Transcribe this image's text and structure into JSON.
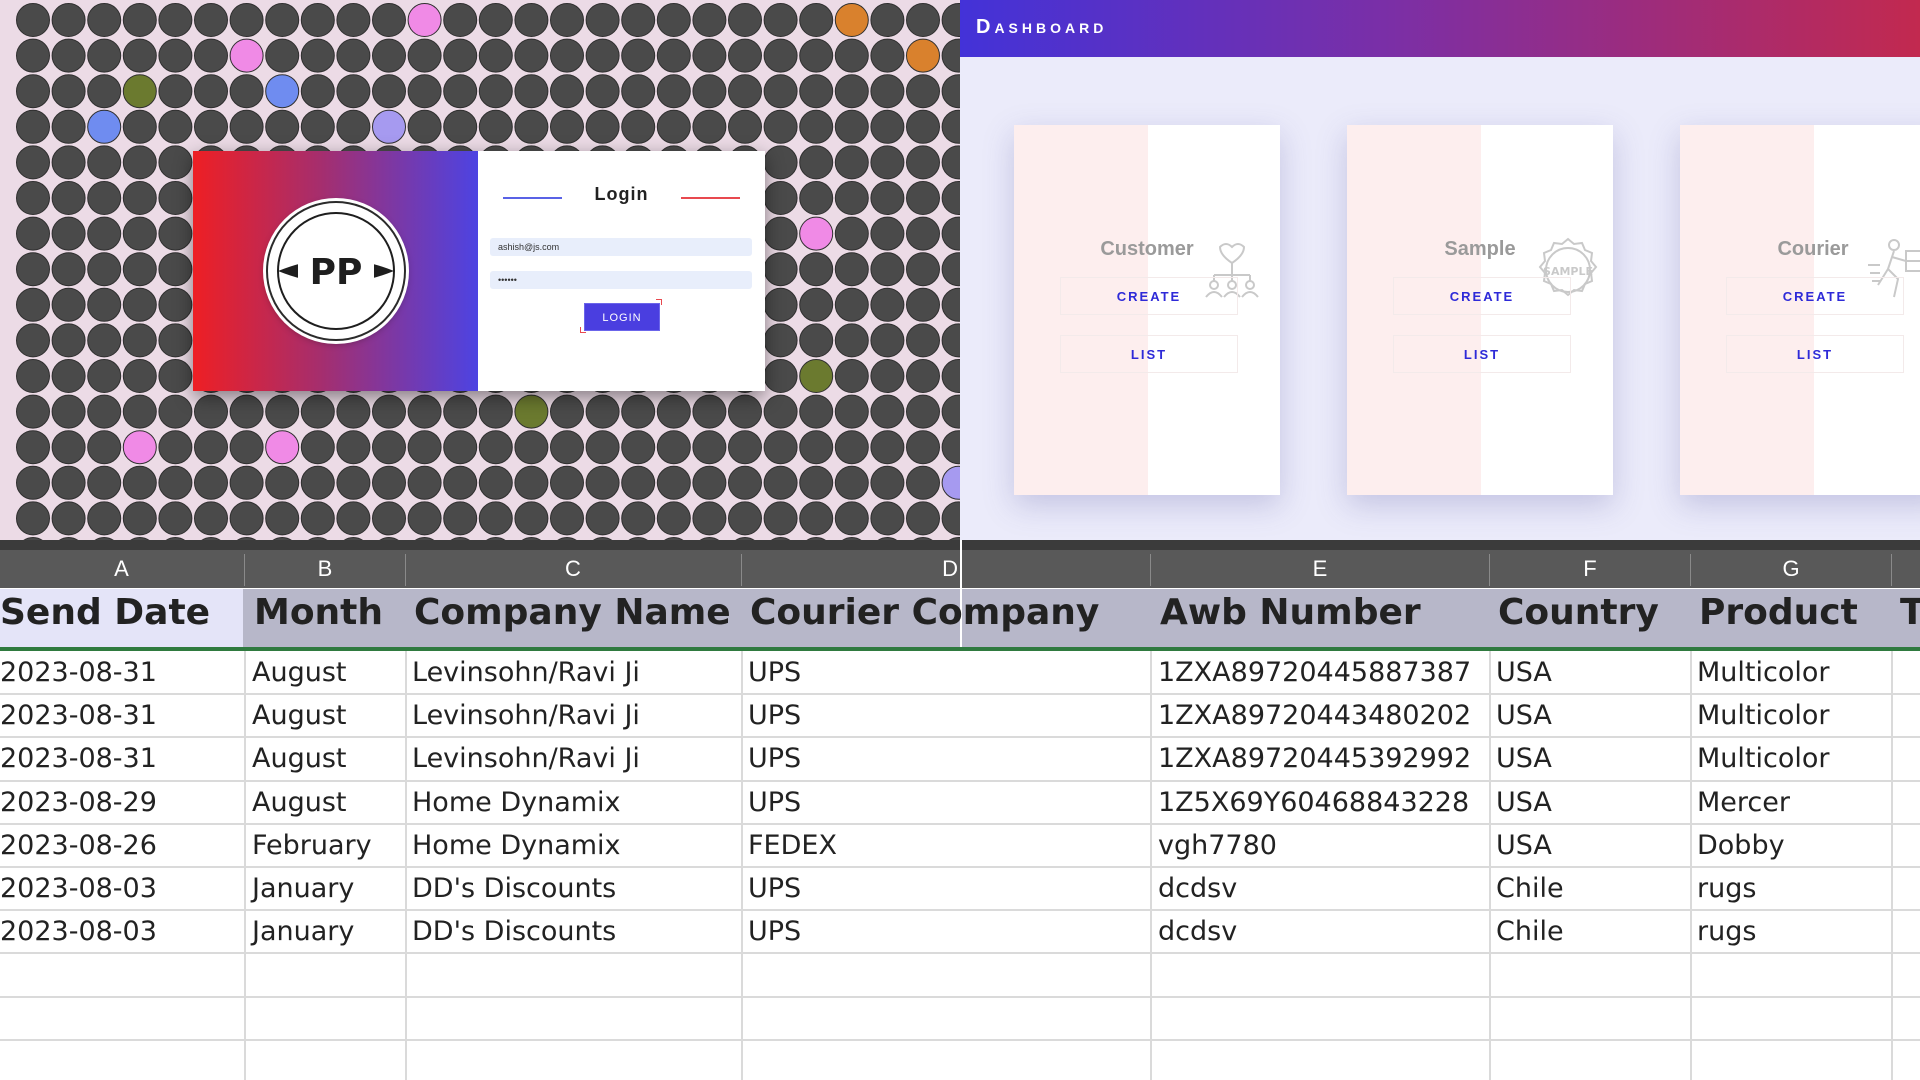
{
  "login": {
    "title": "Login",
    "email_value": "ashish@js.com",
    "password_value": "••••••",
    "button_label": "LOGIN",
    "logo_text": "PP"
  },
  "dashboard": {
    "title": "Dashboard",
    "cards": [
      {
        "title": "Customer",
        "icon": "customer-network-icon",
        "create_label": "CREATE",
        "list_label": "LIST"
      },
      {
        "title": "Sample",
        "icon": "sample-stamp-icon",
        "create_label": "CREATE",
        "list_label": "LIST"
      },
      {
        "title": "Courier",
        "icon": "courier-delivery-icon",
        "create_label": "CREATE",
        "list_label": "LIST"
      }
    ],
    "sample_stamp_text": "SAMPLE"
  },
  "sheet": {
    "column_letters": [
      "A",
      "B",
      "C",
      "D",
      "E",
      "F",
      "G"
    ],
    "headers": [
      "Send Date",
      "Month",
      "Company Name",
      "Courier Company",
      "Awb Number",
      "Country",
      "Product",
      "T"
    ],
    "rows": [
      [
        "2023-08-31",
        "August",
        "Levinsohn/Ravi Ji",
        "UPS",
        "1ZXA89720445887387",
        "USA",
        "Multicolor"
      ],
      [
        "2023-08-31",
        "August",
        "Levinsohn/Ravi Ji",
        "UPS",
        "1ZXA89720443480202",
        "USA",
        "Multicolor"
      ],
      [
        "2023-08-31",
        "August",
        "Levinsohn/Ravi Ji",
        "UPS",
        "1ZXA89720445392992",
        "USA",
        "Multicolor"
      ],
      [
        "2023-08-29",
        "August",
        "Home Dynamix",
        "UPS",
        "1Z5X69Y60468843228",
        "USA",
        "Mercer"
      ],
      [
        "2023-08-26",
        "February",
        "Home Dynamix",
        "FEDEX",
        "vgh7780",
        "USA",
        "Dobby"
      ],
      [
        "2023-08-03",
        "January",
        "DD's Discounts",
        "UPS",
        "dcdsv",
        "Chile",
        "rugs"
      ],
      [
        "2023-08-03",
        "January",
        "DD's Discounts",
        "UPS",
        "dcdsv",
        "Chile",
        "rugs"
      ]
    ]
  },
  "colors": {
    "login_gradient": [
      "#ee1f24",
      "#4d43e2"
    ],
    "dashboard_header": [
      "#4332d8",
      "#c2294f"
    ],
    "accent_blue": "#2e2ad8",
    "dot_dark": "#4a4a4a",
    "dot_pink": "#f08ae6",
    "dot_blue": "#6f8cf0",
    "dot_orange": "#d9812d",
    "dot_olive": "#6b7a2f",
    "dot_lavender": "#a69af0"
  }
}
